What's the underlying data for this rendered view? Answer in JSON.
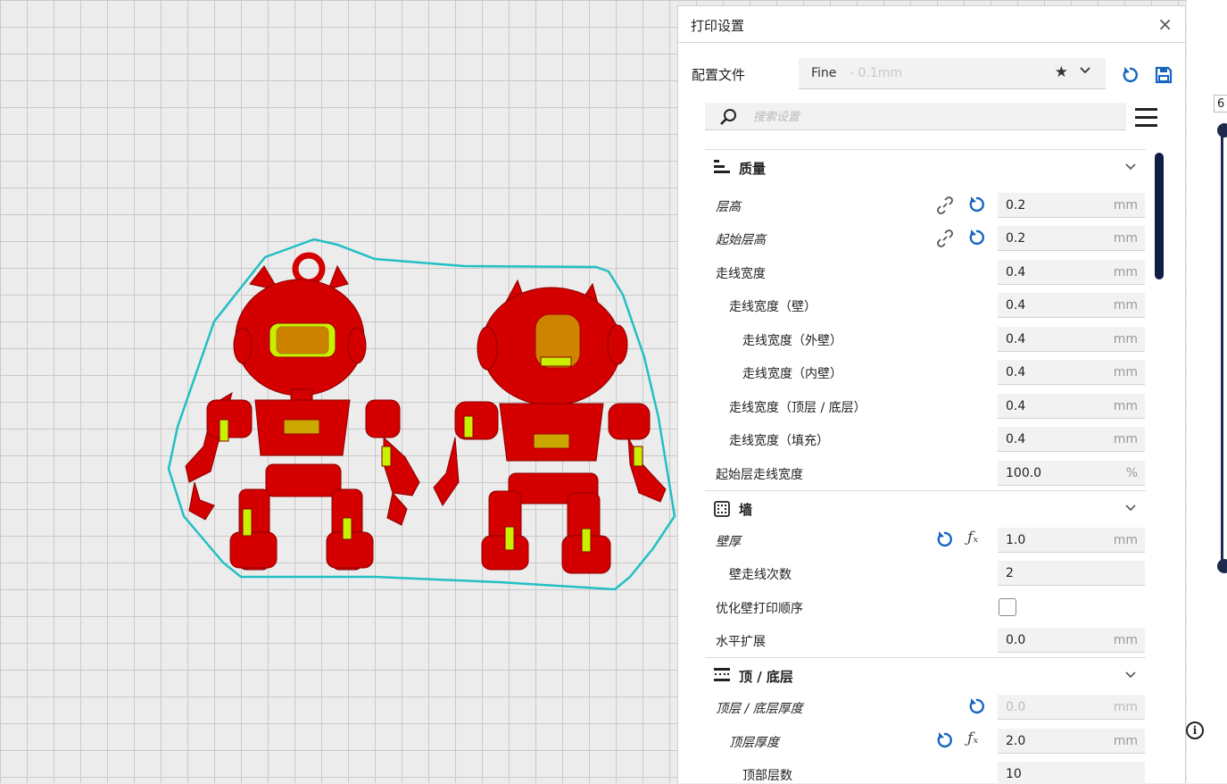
{
  "colors": {
    "accent": "#1565c0",
    "model": "#d40000",
    "highlight": "#c8f000",
    "outline": "#22bfc4"
  },
  "panel": {
    "title": "打印设置",
    "close": "×",
    "profile_label": "配置文件",
    "profile_name": "Fine",
    "profile_sub": "- 0.1mm",
    "search_placeholder": "搜索设置"
  },
  "layer_value": "6",
  "info_glyph": "i",
  "categories": {
    "quality": {
      "title": "质量",
      "rows": [
        {
          "label": "层高",
          "value": "0.2",
          "unit": "mm"
        },
        {
          "label": "起始层高",
          "value": "0.2",
          "unit": "mm"
        },
        {
          "label": "走线宽度",
          "value": "0.4",
          "unit": "mm"
        },
        {
          "label": "走线宽度（壁）",
          "value": "0.4",
          "unit": "mm"
        },
        {
          "label": "走线宽度（外壁）",
          "value": "0.4",
          "unit": "mm"
        },
        {
          "label": "走线宽度（内壁）",
          "value": "0.4",
          "unit": "mm"
        },
        {
          "label": "走线宽度（顶层 / 底层）",
          "value": "0.4",
          "unit": "mm"
        },
        {
          "label": "走线宽度（填充）",
          "value": "0.4",
          "unit": "mm"
        },
        {
          "label": "起始层走线宽度",
          "value": "100.0",
          "unit": "%"
        }
      ]
    },
    "walls": {
      "title": "墙",
      "rows": [
        {
          "label": "壁厚",
          "value": "1.0",
          "unit": "mm"
        },
        {
          "label": "壁走线次数",
          "value": "2",
          "unit": ""
        },
        {
          "label": "优化壁打印顺序",
          "value": "",
          "unit": ""
        },
        {
          "label": "水平扩展",
          "value": "0.0",
          "unit": "mm"
        }
      ]
    },
    "topbottom": {
      "title": "顶 / 底层",
      "rows": [
        {
          "label": "顶层 / 底层厚度",
          "value": "0.0",
          "unit": "mm"
        },
        {
          "label": "顶层厚度",
          "value": "2.0",
          "unit": "mm"
        },
        {
          "label": "顶部层数",
          "value": "10",
          "unit": ""
        }
      ]
    }
  }
}
